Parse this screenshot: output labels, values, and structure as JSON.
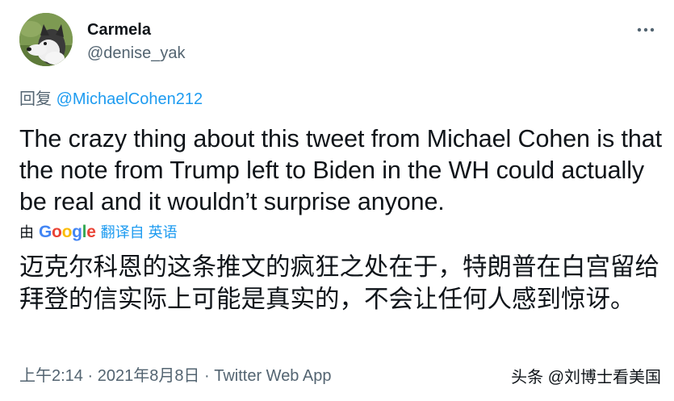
{
  "user": {
    "display_name": "Carmela",
    "handle": "@denise_yak",
    "avatar_icon": "husky-dog-avatar"
  },
  "header": {
    "more_icon": "more-horizontal-icon"
  },
  "reply": {
    "prefix": "回复",
    "mention": "@MichaelCohen212"
  },
  "tweet": {
    "text": "The crazy thing about this tweet from Michael Cohen is that the note from Trump left to Biden in the WH could actually be real and it wouldn’t surprise anyone."
  },
  "translation": {
    "by_label": "由",
    "provider": "Google",
    "link_label": "翻译自 英语",
    "text": "迈克尔科恩的这条推文的疯狂之处在于，特朗普在白宫留给拜登的信实际上可能是真实的，不会让任何人感到惊讶。"
  },
  "meta": {
    "time": "上午2:14 · 2021年8月8日",
    "separator": " · ",
    "source": "Twitter Web App"
  },
  "watermark": {
    "text": "头条 @刘博士看美国"
  },
  "colors": {
    "link": "#1d9bf0",
    "secondary_text": "#536471",
    "primary_text": "#0f1419"
  }
}
